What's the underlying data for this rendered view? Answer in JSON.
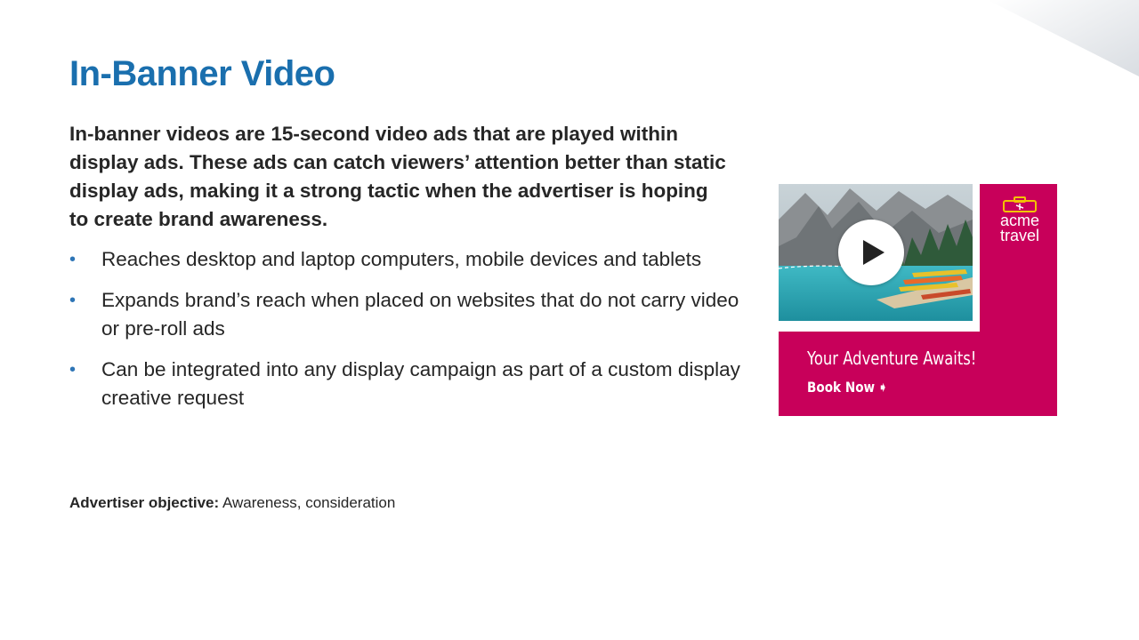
{
  "slide": {
    "title": "In-Banner Video",
    "intro": "In-banner videos are 15-second video ads that are played within display ads. These ads can catch viewers’ attention better than static display ads, making it a strong tactic when the advertiser is hoping to create brand awareness.",
    "bullets": [
      "Reaches desktop and laptop computers, mobile devices and tablets",
      "Expands brand’s reach when placed on websites that do not carry video or pre-roll ads",
      "Can be integrated into any display campaign as part of a custom display creative request"
    ],
    "objective_label": "Advertiser objective:",
    "objective_value": " Awareness, consideration"
  },
  "ad": {
    "logo_line1": "acme",
    "logo_line2": "travel",
    "headline": "Your Adventure Awaits!",
    "cta": "Book Now",
    "photo": "mountain-lake-canoes",
    "play_icon": "play-icon"
  },
  "colors": {
    "title": "#1a6fae",
    "bullet": "#2e75b6",
    "ad_background": "#c8005a",
    "logo_accent": "#f2c300",
    "text": "#262626"
  }
}
